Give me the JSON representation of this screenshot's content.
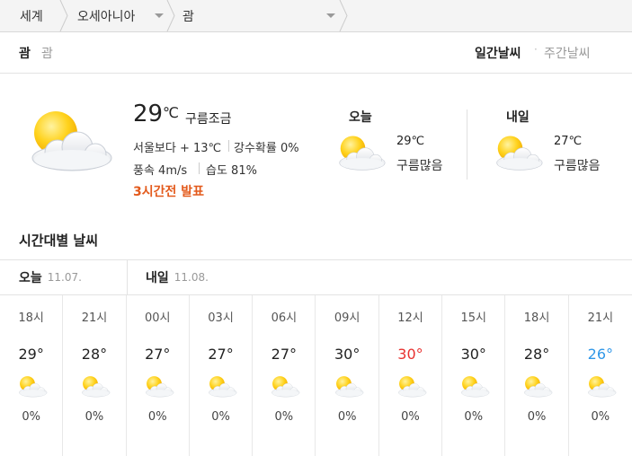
{
  "breadcrumb": {
    "world": "세계",
    "region": "오세아니아",
    "city": "괌"
  },
  "location": {
    "name": "괌",
    "sub": "괌",
    "view_daily": "일간날씨",
    "view_dot": "·",
    "view_weekly": "주간날씨"
  },
  "current": {
    "temp": "29",
    "unit": "℃",
    "condition": "구름조금",
    "compare": "서울보다 + 13℃",
    "precip": "강수확률 0%",
    "wind": "풍속 4m/s",
    "humidity": "습도 81%",
    "announce": "3시간전 발표",
    "icon": "partly-cloudy-icon"
  },
  "today": {
    "title": "오늘",
    "temp": "29℃",
    "condition": "구름많음",
    "icon": "partly-cloudy-icon"
  },
  "tomorrow": {
    "title": "내일",
    "temp": "27℃",
    "condition": "구름많음",
    "icon": "partly-cloudy-icon"
  },
  "hourly": {
    "title": "시간대별 날씨",
    "dates": [
      {
        "label": "오늘",
        "date": "11.07."
      },
      {
        "label": "내일",
        "date": "11.08."
      }
    ],
    "items": [
      {
        "time": "18시",
        "temp": "29°",
        "pop": "0%",
        "tone": "normal"
      },
      {
        "time": "21시",
        "temp": "28°",
        "pop": "0%",
        "tone": "normal"
      },
      {
        "time": "00시",
        "temp": "27°",
        "pop": "0%",
        "tone": "normal"
      },
      {
        "time": "03시",
        "temp": "27°",
        "pop": "0%",
        "tone": "normal"
      },
      {
        "time": "06시",
        "temp": "27°",
        "pop": "0%",
        "tone": "normal"
      },
      {
        "time": "09시",
        "temp": "30°",
        "pop": "0%",
        "tone": "normal"
      },
      {
        "time": "12시",
        "temp": "30°",
        "pop": "0%",
        "tone": "hot"
      },
      {
        "time": "15시",
        "temp": "30°",
        "pop": "0%",
        "tone": "normal"
      },
      {
        "time": "18시",
        "temp": "28°",
        "pop": "0%",
        "tone": "normal"
      },
      {
        "time": "21시",
        "temp": "26°",
        "pop": "0%",
        "tone": "cool"
      }
    ]
  },
  "colors": {
    "max_temp": "#e8312f",
    "min_temp": "#2f97e8",
    "announce": "#e35a1c"
  }
}
